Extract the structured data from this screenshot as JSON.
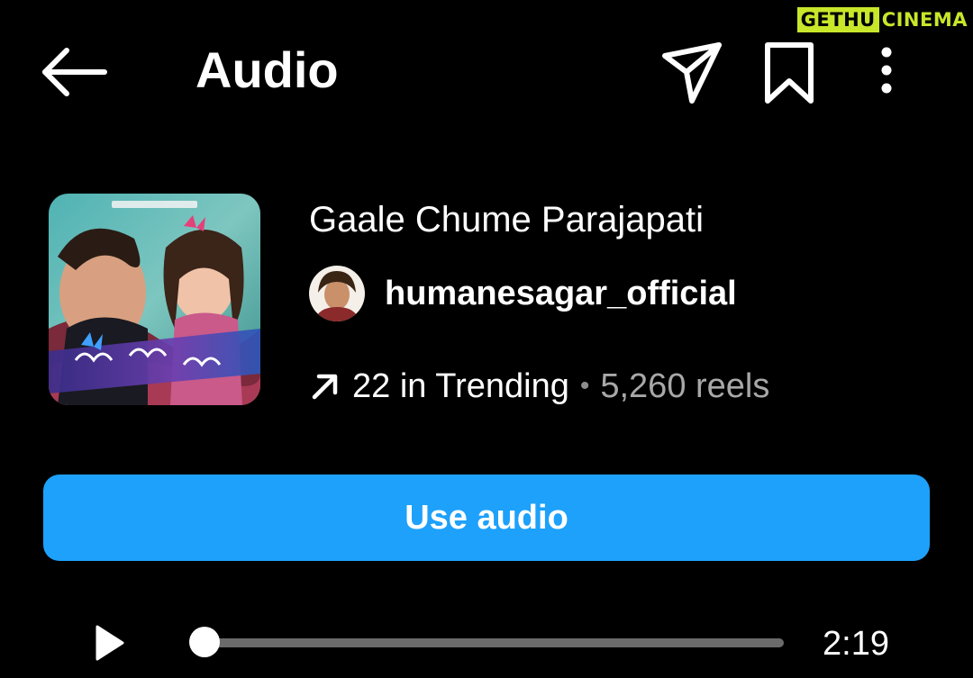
{
  "watermark": {
    "part_a": "GETHU",
    "part_b": "CINEMA",
    "color": "#c8e62a"
  },
  "header": {
    "title": "Audio",
    "back_icon": "arrow-left-icon",
    "share_icon": "paper-plane-icon",
    "save_icon": "bookmark-icon",
    "more_icon": "more-vertical-icon"
  },
  "track": {
    "title": "Gaale Chume Parajapati",
    "artist": "humanesagar_official",
    "trend_icon": "arrow-up-right-icon",
    "trending_text": "22 in Trending",
    "separator": "•",
    "reels_text": "5,260 reels"
  },
  "actions": {
    "use_audio_label": "Use audio",
    "accent_color": "#1da1fb"
  },
  "player": {
    "play_icon": "play-icon",
    "progress": 0.0,
    "duration": "2:19"
  }
}
